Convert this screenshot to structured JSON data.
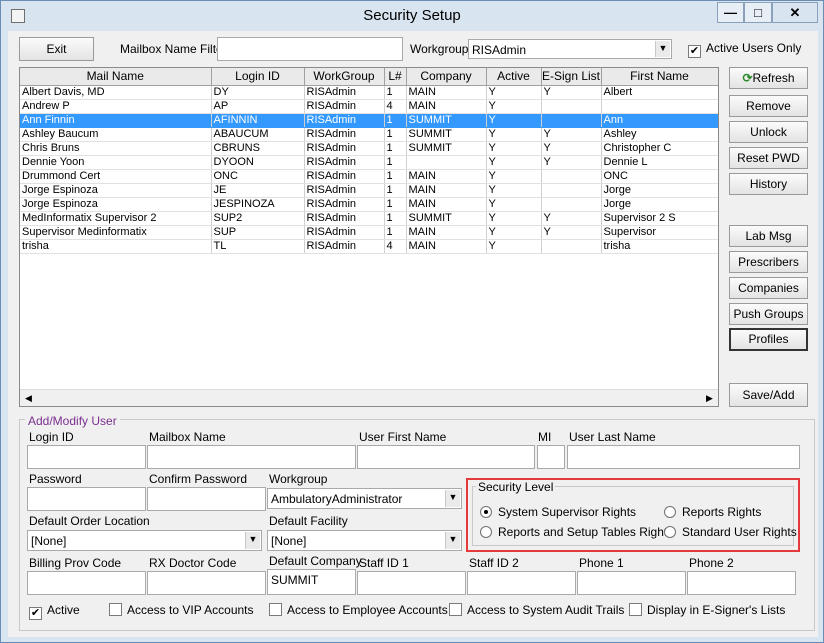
{
  "window": {
    "title": "Security Setup",
    "minimize": "—",
    "maximize": "□",
    "close": "✕"
  },
  "toolbar": {
    "exit_label": "Exit",
    "mailbox_filter_label": "Mailbox Name Filter",
    "mailbox_filter_value": "",
    "workgroup_label": "Workgroup",
    "workgroup_value": "RISAdmin",
    "active_only_label": "Active Users Only",
    "active_only_checked": true
  },
  "grid": {
    "columns": [
      "Mail Name",
      "Login ID",
      "WorkGroup",
      "L#",
      "Company",
      "Active",
      "E-Sign List",
      "First Name"
    ],
    "rows": [
      [
        "Albert Davis, MD",
        "DY",
        "RISAdmin",
        "1",
        "MAIN",
        "Y",
        "Y",
        "Albert"
      ],
      [
        "Andrew P",
        "AP",
        "RISAdmin",
        "4",
        "MAIN",
        "Y",
        "",
        ""
      ],
      [
        "Ann Finnin",
        "AFINNIN",
        "RISAdmin",
        "1",
        "SUMMIT",
        "Y",
        "",
        "Ann"
      ],
      [
        "Ashley Baucum",
        "ABAUCUM",
        "RISAdmin",
        "1",
        "SUMMIT",
        "Y",
        "Y",
        "Ashley"
      ],
      [
        "Chris Bruns",
        "CBRUNS",
        "RISAdmin",
        "1",
        "SUMMIT",
        "Y",
        "Y",
        "Christopher C"
      ],
      [
        "Dennie Yoon",
        "DYOON",
        "RISAdmin",
        "1",
        "",
        "Y",
        "Y",
        "Dennie L"
      ],
      [
        "Drummond Cert",
        "ONC",
        "RISAdmin",
        "1",
        "MAIN",
        "Y",
        "",
        "ONC"
      ],
      [
        "Jorge Espinoza",
        "JE",
        "RISAdmin",
        "1",
        "MAIN",
        "Y",
        "",
        "Jorge"
      ],
      [
        "Jorge Espinoza",
        "JESPINOZA",
        "RISAdmin",
        "1",
        "MAIN",
        "Y",
        "",
        "Jorge"
      ],
      [
        "MedInformatix Supervisor 2",
        "SUP2",
        "RISAdmin",
        "1",
        "SUMMIT",
        "Y",
        "Y",
        "Supervisor 2 S"
      ],
      [
        "Supervisor Medinformatix",
        "SUP",
        "RISAdmin",
        "1",
        "MAIN",
        "Y",
        "Y",
        "Supervisor"
      ],
      [
        "trisha",
        "TL",
        "RISAdmin",
        "4",
        "MAIN",
        "Y",
        "",
        "trisha"
      ]
    ],
    "selected_row": 2
  },
  "side_buttons": {
    "refresh": "Refresh",
    "remove": "Remove",
    "unlock": "Unlock",
    "reset_pwd": "Reset PWD",
    "history": "History",
    "lab_msg": "Lab Msg",
    "prescribers": "Prescribers",
    "companies": "Companies",
    "push_groups": "Push Groups",
    "profiles": "Profiles",
    "save_add": "Save/Add"
  },
  "form": {
    "group_title": "Add/Modify User",
    "login_id_label": "Login ID",
    "mailbox_name_label": "Mailbox Name",
    "user_first_name_label": "User First Name",
    "mi_label": "MI",
    "user_last_name_label": "User Last Name",
    "password_label": "Password",
    "confirm_password_label": "Confirm Password",
    "workgroup_label": "Workgroup",
    "workgroup_value": "AmbulatoryAdministrator",
    "default_order_location_label": "Default Order Location",
    "default_order_location_value": "[None]",
    "default_facility_label": "Default Facility",
    "default_facility_value": "[None]",
    "billing_prov_code_label": "Billing Prov Code",
    "rx_doctor_code_label": "RX Doctor Code",
    "default_company_label": "Default Company",
    "default_company_value": "SUMMIT",
    "staff_id1_label": "Staff ID 1",
    "staff_id2_label": "Staff ID 2",
    "phone1_label": "Phone 1",
    "phone2_label": "Phone 2",
    "security_level": {
      "title": "Security Level",
      "options": [
        "System Supervisor Rights",
        "Reports Rights",
        "Reports and Setup Tables Rights",
        "Standard User Rights"
      ],
      "selected": "System Supervisor Rights"
    },
    "checkboxes": [
      {
        "label": "Active",
        "checked": true
      },
      {
        "label": "Access to VIP Accounts",
        "checked": false
      },
      {
        "label": "Access to Employee Accounts",
        "checked": false
      },
      {
        "label": "Access to System Audit Trails",
        "checked": false
      },
      {
        "label": "Display in E-Signer's Lists",
        "checked": false
      }
    ]
  },
  "colors": {
    "selection": "#3399ff",
    "security_highlight": "#e63a3a",
    "group_title": "#7a2f8e"
  }
}
